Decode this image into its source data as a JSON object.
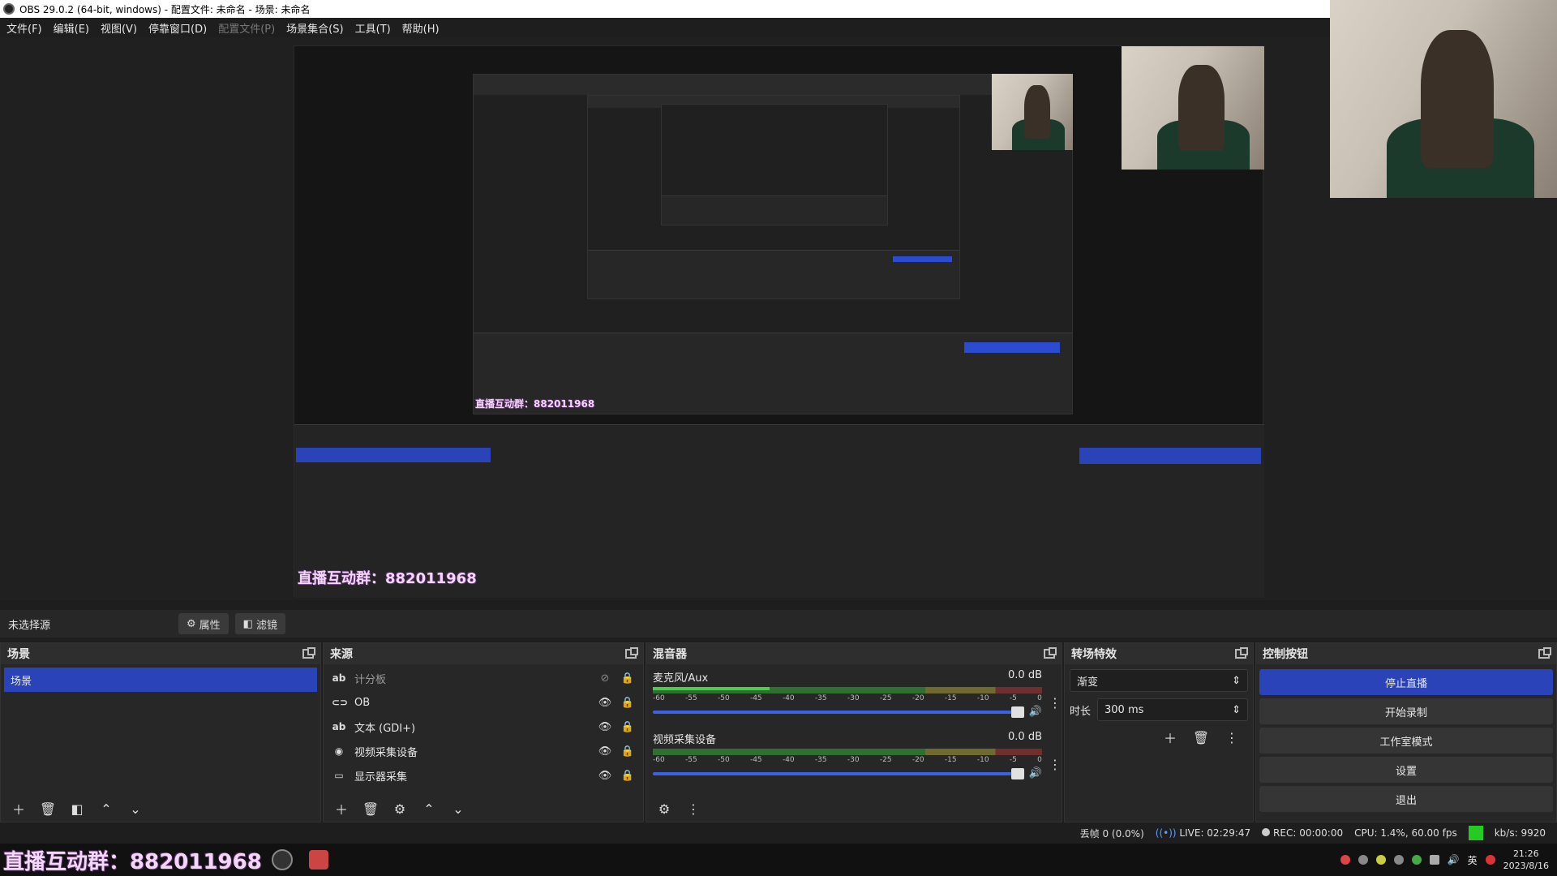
{
  "window": {
    "title": "OBS 29.0.2 (64-bit, windows) - 配置文件: 未命名 - 场景: 未命名"
  },
  "menu": [
    "文件(F)",
    "编辑(E)",
    "视图(V)",
    "停靠窗口(D)",
    "配置文件(P)",
    "场景集合(S)",
    "工具(T)",
    "帮助(H)"
  ],
  "preview": {
    "overlay_text": "直播互动群：",
    "overlay_number": "882011968"
  },
  "sourcebar": {
    "no_source": "未选择源",
    "properties": "属性",
    "filters": "滤镜"
  },
  "scenes": {
    "title": "场景",
    "items": [
      "场景"
    ]
  },
  "sources": {
    "title": "来源",
    "items": [
      {
        "icon": "ab",
        "label": "计分板",
        "hidden": true
      },
      {
        "icon": "⊂⊃",
        "label": "OB",
        "hidden": false
      },
      {
        "icon": "ab",
        "label": "文本 (GDI+)",
        "hidden": false
      },
      {
        "icon": "◉",
        "label": "视频采集设备",
        "hidden": false
      },
      {
        "icon": "▭",
        "label": "显示器采集",
        "hidden": false
      }
    ]
  },
  "mixer": {
    "title": "混音器",
    "ticks": [
      "-60",
      "-55",
      "-50",
      "-45",
      "-40",
      "-35",
      "-30",
      "-25",
      "-20",
      "-15",
      "-10",
      "-5",
      "0"
    ],
    "channels": [
      {
        "name": "麦克风/Aux",
        "db": "0.0 dB",
        "level": 0.3
      },
      {
        "name": "视频采集设备",
        "db": "0.0 dB",
        "level": 0.0
      }
    ]
  },
  "transitions": {
    "title": "转场特效",
    "selected": "渐变",
    "duration_label": "时长",
    "duration_value": "300 ms"
  },
  "controls": {
    "title": "控制按钮",
    "stop_stream": "停止直播",
    "start_record": "开始录制",
    "studio_mode": "工作室模式",
    "settings": "设置",
    "exit": "退出"
  },
  "status": {
    "dropped": "丢帧 0 (0.0%)",
    "live": "LIVE: 02:29:47",
    "rec": "REC: 00:00:00",
    "cpu": "CPU: 1.4%, 60.00 fps",
    "kbs": "kb/s: 9920"
  },
  "taskbar": {
    "ime": "英",
    "time": "21:26",
    "date": "2023/8/16"
  },
  "colors": {
    "accent": "#2a43b8",
    "status_green": "#22cc22"
  }
}
